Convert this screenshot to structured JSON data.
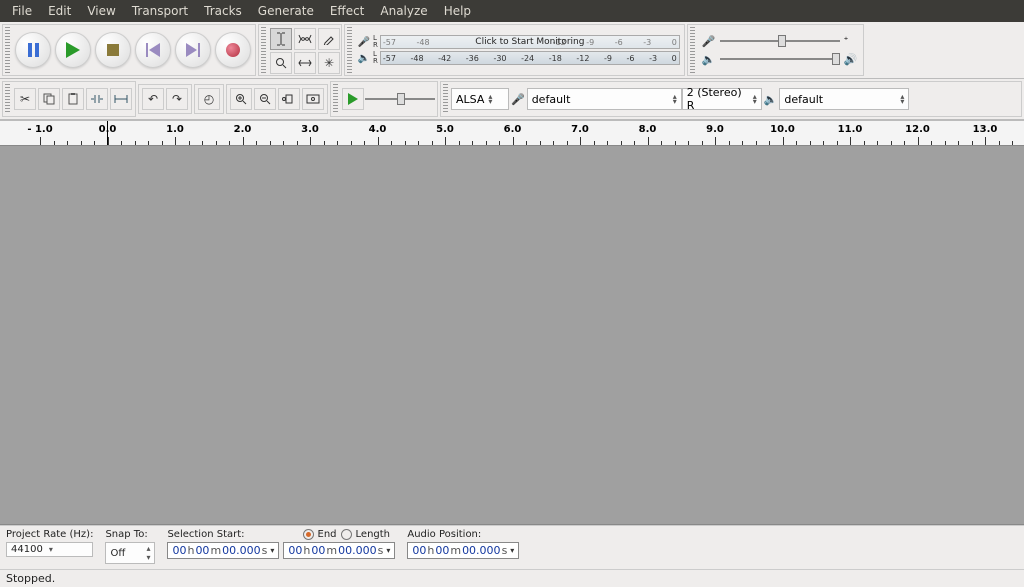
{
  "menu": [
    "File",
    "Edit",
    "View",
    "Transport",
    "Tracks",
    "Generate",
    "Effect",
    "Analyze",
    "Help"
  ],
  "meter": {
    "ticks": [
      "-57",
      "-48",
      "-42",
      "-36",
      "-30",
      "-24",
      "-18",
      "-12",
      "-9",
      "-6",
      "-3",
      "0"
    ],
    "rec_ticks_visible": [
      "-57",
      "-48",
      "",
      "",
      "",
      "",
      "",
      "-12",
      "-9",
      "-6",
      "-3",
      "0"
    ],
    "monitor_text": "Click to Start Monitoring"
  },
  "device": {
    "host_label": "ALSA",
    "input_label": "default",
    "channels_label": "2 (Stereo) R",
    "output_label": "default"
  },
  "timeline": {
    "labels": [
      "- 1.0",
      "0.0",
      "1.0",
      "2.0",
      "3.0",
      "4.0",
      "5.0",
      "6.0",
      "7.0",
      "8.0",
      "9.0",
      "10.0",
      "11.0",
      "12.0",
      "13.0"
    ]
  },
  "bottom": {
    "project_rate_label": "Project Rate (Hz):",
    "project_rate_value": "44100",
    "snap_label": "Snap To:",
    "snap_value": "Off",
    "sel_start_label": "Selection Start:",
    "end_label": "End",
    "length_label": "Length",
    "audio_pos_label": "Audio Position:",
    "time_h": "00",
    "time_m": "00",
    "time_s": "00.000"
  },
  "status": "Stopped."
}
